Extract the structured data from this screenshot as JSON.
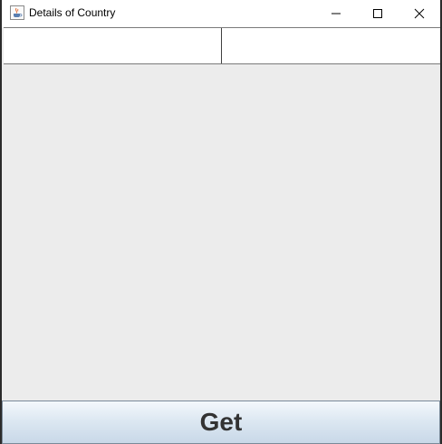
{
  "window": {
    "title": "Details of Country",
    "icon": "java-cup-icon"
  },
  "title_controls": {
    "minimize": "minimize-icon",
    "maximize": "maximize-icon",
    "close": "close-icon"
  },
  "fields": {
    "left_value": "",
    "right_value": ""
  },
  "actions": {
    "get_label": "Get"
  }
}
